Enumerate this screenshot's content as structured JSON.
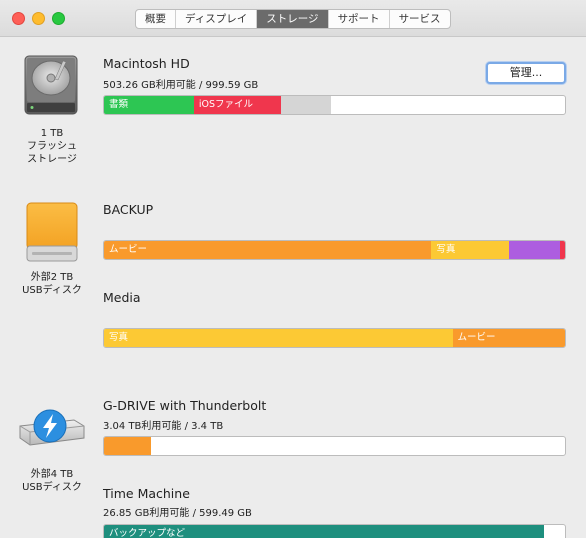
{
  "tabs": [
    {
      "label": "概要",
      "active": false
    },
    {
      "label": "ディスプレイ",
      "active": false
    },
    {
      "label": "ストレージ",
      "active": true
    },
    {
      "label": "サポート",
      "active": false
    },
    {
      "label": "サービス",
      "active": false
    }
  ],
  "devices": [
    {
      "label": "1 TB\nフラッシュ\nストレージ",
      "icon": "internal-drive-icon"
    },
    {
      "label": "外部2 TB\nUSBディスク",
      "icon": "external-drive-icon"
    },
    {
      "label": "外部4 TB\nUSBディスク",
      "icon": "thunderbolt-drive-icon"
    }
  ],
  "volumes": [
    {
      "name": "Macintosh HD",
      "info": "503.26 GB利用可能 / 999.59 GB",
      "manage_label": "管理...",
      "segments": [
        {
          "label": "書類",
          "fraction": 0.195,
          "color": "#2dc653"
        },
        {
          "label": "iOSファイル",
          "fraction": 0.19,
          "color": "#f0364d"
        },
        {
          "label": "",
          "fraction": 0.108,
          "color": "#d5d5d5"
        }
      ]
    },
    {
      "name": "BACKUP",
      "info": "",
      "segments": [
        {
          "label": "ムービー",
          "fraction": 0.713,
          "color": "#f99a2c"
        },
        {
          "label": "写真",
          "fraction": 0.168,
          "color": "#fcc934"
        },
        {
          "label": "",
          "fraction": 0.112,
          "color": "#ad5ee0"
        },
        {
          "label": "",
          "fraction": 0.007,
          "color": "#f0364d"
        }
      ]
    },
    {
      "name": "Media",
      "info": "",
      "segments": [
        {
          "label": "写真",
          "fraction": 0.756,
          "color": "#fcc934"
        },
        {
          "label": "ムービー",
          "fraction": 0.244,
          "color": "#f99a2c"
        }
      ]
    },
    {
      "name": "G-DRIVE with Thunderbolt",
      "info": "3.04 TB利用可能 / 3.4 TB",
      "segments": [
        {
          "label": "",
          "fraction": 0.103,
          "color": "#f99a2c"
        }
      ]
    },
    {
      "name": "Time Machine",
      "info": "26.85 GB利用可能 / 599.49 GB",
      "segments": [
        {
          "label": "バックアップなど",
          "fraction": 0.955,
          "color": "#1e8f7e"
        }
      ]
    }
  ]
}
